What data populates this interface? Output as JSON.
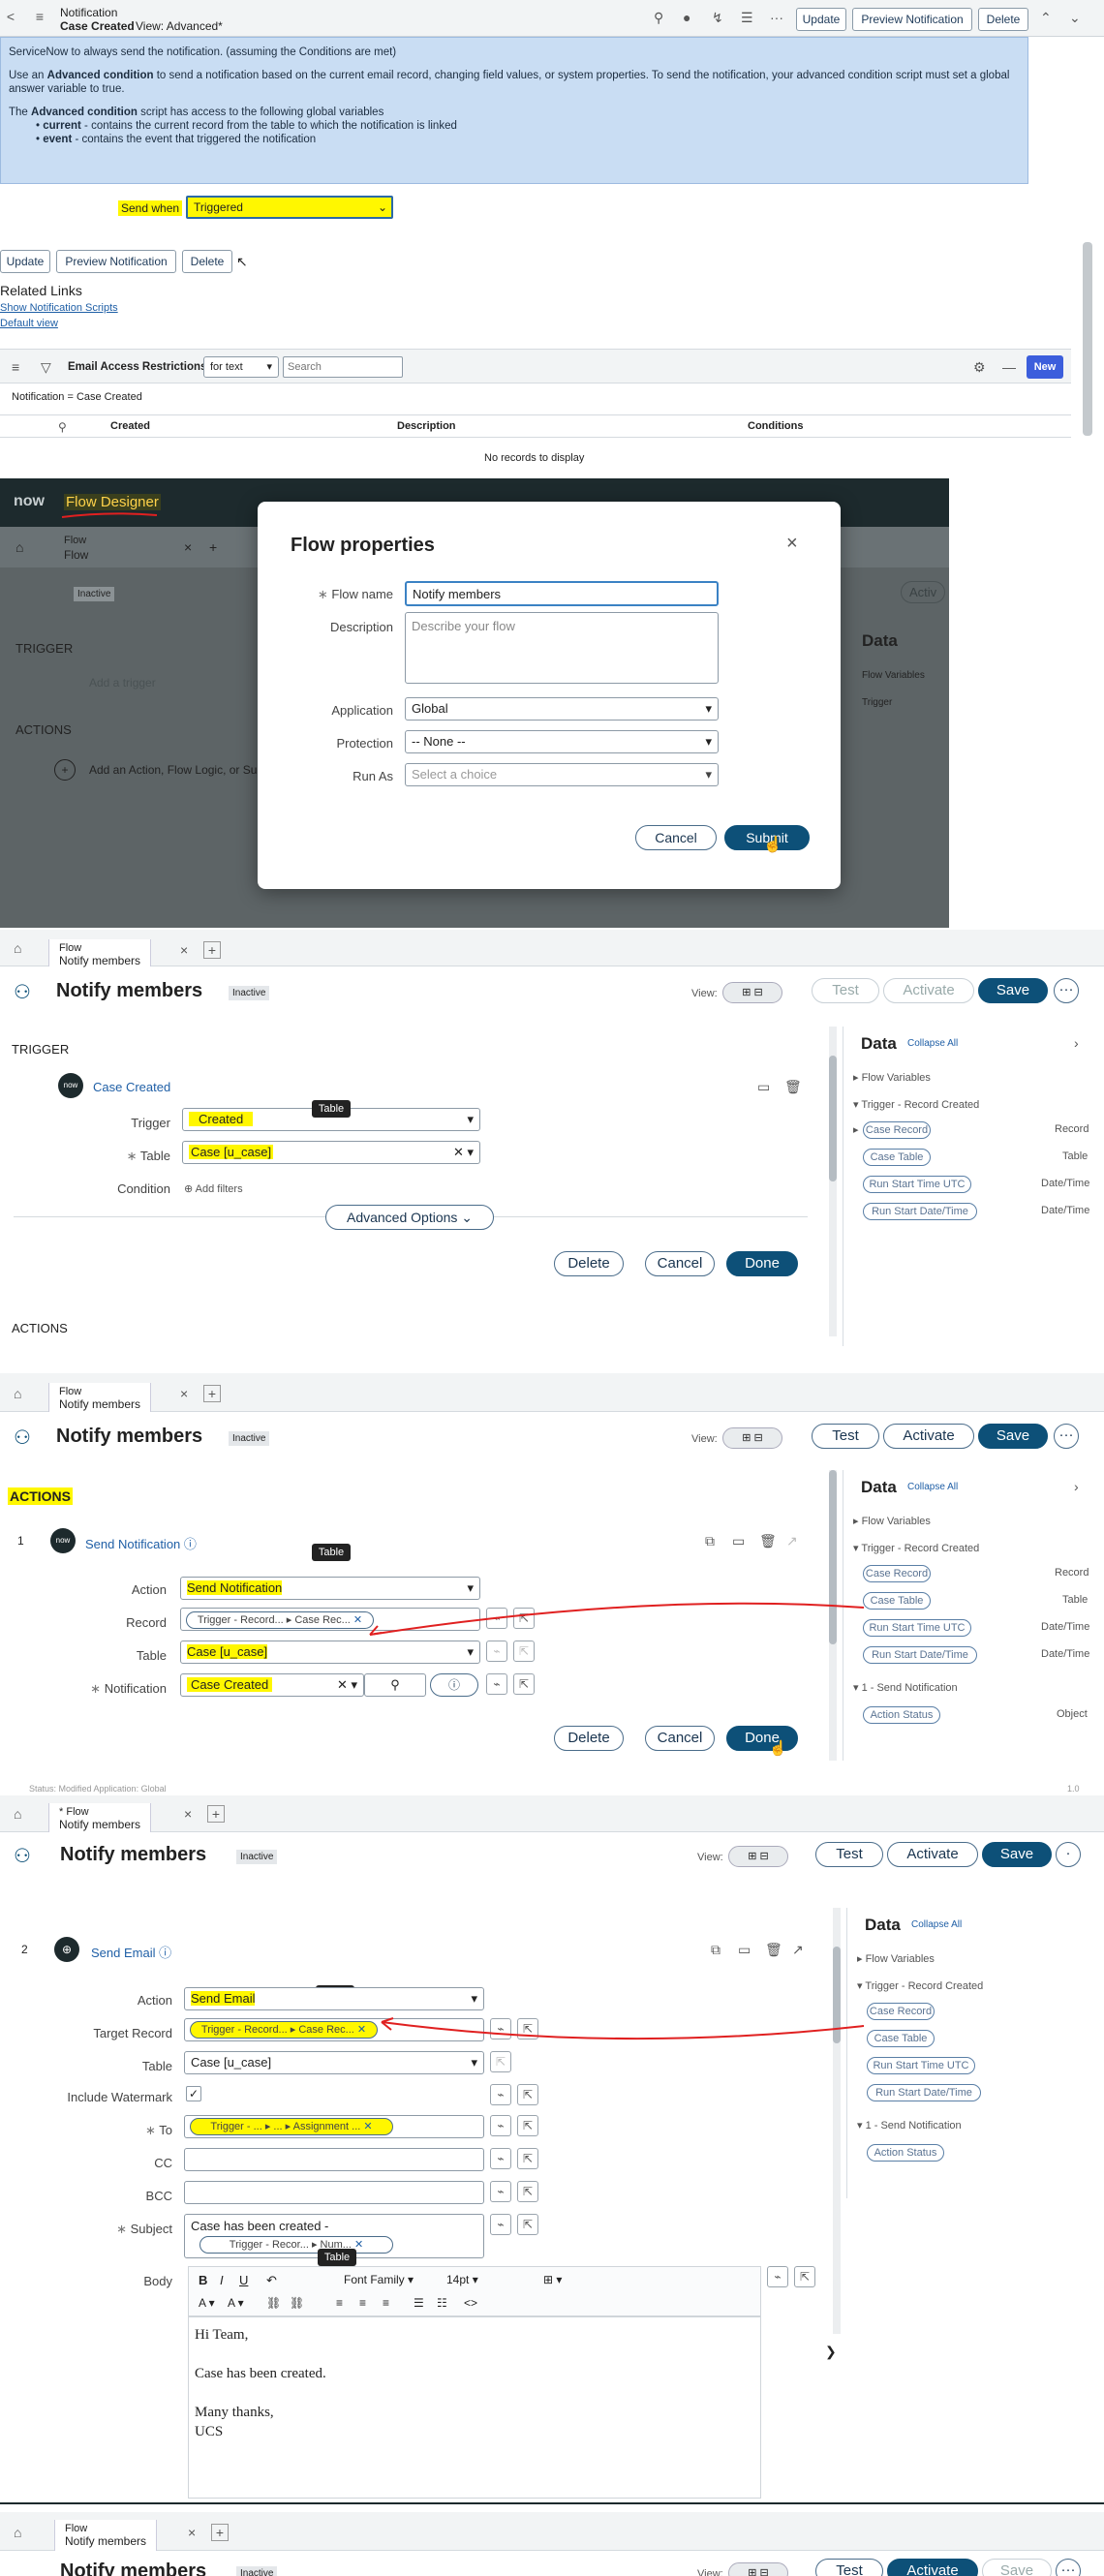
{
  "s1": {
    "crumb": "Notification",
    "record": "Case Created",
    "view": "View: Advanced*",
    "btn_update": "Update",
    "btn_preview": "Preview Notification",
    "btn_delete": "Delete",
    "p1": "ServiceNow to always send the notification. (assuming the Conditions are met)",
    "p2a": "Use an ",
    "p2b": "Advanced condition",
    "p2c": " to send a notification based on the current email record, changing field values, or system properties. To send the notification, your advanced condition script must set a global answer variable to true.",
    "p3a": "The ",
    "p3b": "Advanced condition",
    "p3c": " script has access to the following global variables",
    "b1a": "current",
    "b1b": " - contains the current record from the table to which the notification is linked",
    "b2a": "event",
    "b2b": " - contains the event that triggered the notification",
    "sendwhen_label": "Send when",
    "sendwhen_value": "Triggered",
    "related": "Related Links",
    "link1": "Show Notification Scripts",
    "link2": "Default view",
    "list_title": "Email Access Restrictions",
    "filter_field": "for text",
    "search_ph": "Search",
    "new_btn": "New",
    "filter": "Notification = Case Created",
    "cols": [
      "Created",
      "Description",
      "Conditions"
    ],
    "empty": "No records to display"
  },
  "s2": {
    "logo": "now",
    "product": "Flow Designer",
    "tab_label": "Flow",
    "tab_sub": "Flow",
    "inactive": "Inactive",
    "trigger": "TRIGGER",
    "add_trigger": "Add a trigger",
    "actions": "ACTIONS",
    "add_action": "Add an Action, Flow Logic, or Su",
    "data": "Data",
    "flow_vars": "Flow Variables",
    "trig": "Trigger",
    "modal_title": "Flow properties",
    "name_label": "Flow name",
    "name_value": "Notify members",
    "desc_label": "Description",
    "desc_ph": "Describe your flow",
    "app_label": "Application",
    "app_value": "Global",
    "prot_label": "Protection",
    "prot_value": "-- None --",
    "runas_label": "Run As",
    "runas_value": "Select a choice",
    "cancel": "Cancel",
    "submit": "Submit",
    "bg_a": "Activ"
  },
  "flow": {
    "tab_top": "Flow",
    "tab_name": "Notify members",
    "tab_star": "*",
    "title": "Notify members",
    "status": "Inactive",
    "view": "View:",
    "test": "Test",
    "activate": "Activate",
    "save": "Save",
    "data": "Data",
    "collapse": "Collapse All",
    "flow_vars": "Flow Variables",
    "trig_rec": "Trigger - Record Created",
    "pills": [
      "Case Record",
      "Case Table",
      "Run Start Time UTC",
      "Run Start Date/Time"
    ],
    "types": [
      "Record",
      "Table",
      "Date/Time",
      "Date/Time"
    ],
    "send_notif": "1 - Send Notification",
    "action_status": "Action Status",
    "obj": "Object",
    "delete": "Delete",
    "cancel": "Cancel",
    "done": "Done",
    "tooltip": "Table"
  },
  "s3": {
    "trigger": "TRIGGER",
    "case_created": "Case Created",
    "trig_label": "Trigger",
    "trig_value": "Created",
    "table_label": "Table",
    "table_value": "Case [u_case]",
    "cond_label": "Condition",
    "add_filters": "Add filters",
    "adv": "Advanced Options",
    "actions": "ACTIONS"
  },
  "s4": {
    "actions": "ACTIONS",
    "num": "1",
    "name": "Send Notification",
    "action_label": "Action",
    "action_value": "Send Notification",
    "record_label": "Record",
    "record_chip": "Trigger - Record... ▸ Case Rec...",
    "table_label": "Table",
    "table_value": "Case [u_case]",
    "notif_label": "Notification",
    "notif_value": "Case Created"
  },
  "s5": {
    "status": "Status: Modified   Application: Global",
    "ver": "1.0",
    "num": "2",
    "name": "Send Email",
    "action_label": "Action",
    "action_value": "Send Email",
    "target_label": "Target Record",
    "target_chip": "Trigger - Record... ▸ Case Rec...",
    "table_label": "Table",
    "table_value": "Case [u_case]",
    "wm_label": "Include Watermark",
    "to_label": "To",
    "to_chip": "Trigger - ... ▸ ... ▸ Assignment ...",
    "cc_label": "CC",
    "bcc_label": "BCC",
    "subject_label": "Subject",
    "subject_text": "Case has been created -",
    "subject_chip": "Trigger - Recor... ▸ Num...",
    "body_label": "Body",
    "font_family": "Font Family",
    "font_size": "14pt",
    "body_lines": [
      "Hi Team,",
      "",
      "Case has been created.",
      "",
      "Many thanks,",
      "UCS"
    ]
  },
  "colors": {
    "highlight": "#fff700",
    "primary": "#0d5078",
    "annotation": "#e02020",
    "dark_header": "#293e40",
    "info_bg": "#c9ddf3"
  }
}
